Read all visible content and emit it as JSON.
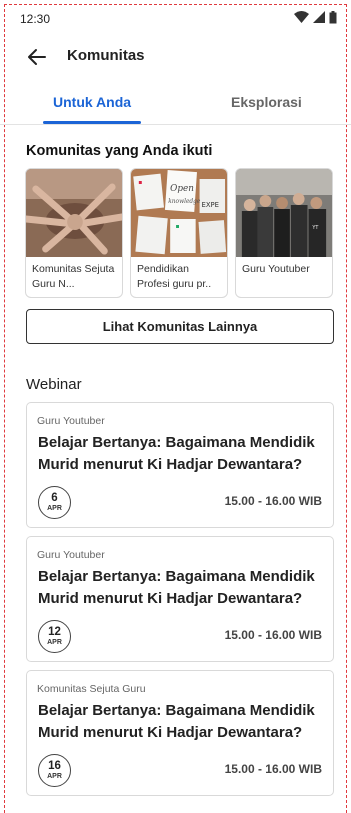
{
  "status_bar": {
    "time": "12:30"
  },
  "app_bar": {
    "title": "Komunitas"
  },
  "tabs": [
    {
      "label": "Untuk Anda",
      "active": true
    },
    {
      "label": "Eksplorasi",
      "active": false
    }
  ],
  "followed": {
    "heading": "Komunitas yang Anda ikuti",
    "items": [
      {
        "label": "Komunitas Sejuta Guru N..."
      },
      {
        "label": "Pendidikan Profesi guru pr.."
      },
      {
        "label": "Guru Youtuber"
      }
    ],
    "more_button": "Lihat Komunitas Lainnya"
  },
  "webinar": {
    "heading": "Webinar",
    "items": [
      {
        "org": "Guru Youtuber",
        "title": "Belajar Bertanya: Bagaimana Mendidik Murid menurut Ki Hadjar Dewantara?",
        "day": "6",
        "month": "APR",
        "time": "15.00 - 16.00 WIB"
      },
      {
        "org": "Guru Youtuber",
        "title": "Belajar Bertanya: Bagaimana Mendidik Murid menurut Ki Hadjar Dewantara?",
        "day": "12",
        "month": "APR",
        "time": "15.00 - 16.00 WIB"
      },
      {
        "org": "Komunitas Sejuta Guru",
        "title": "Belajar Bertanya: Bagaimana Mendidik Murid menurut Ki Hadjar Dewantara?",
        "day": "16",
        "month": "APR",
        "time": "15.00 - 16.00 WIB"
      }
    ]
  },
  "colors": {
    "accent": "#1b64d6",
    "frame_guide": "#e0393e"
  }
}
